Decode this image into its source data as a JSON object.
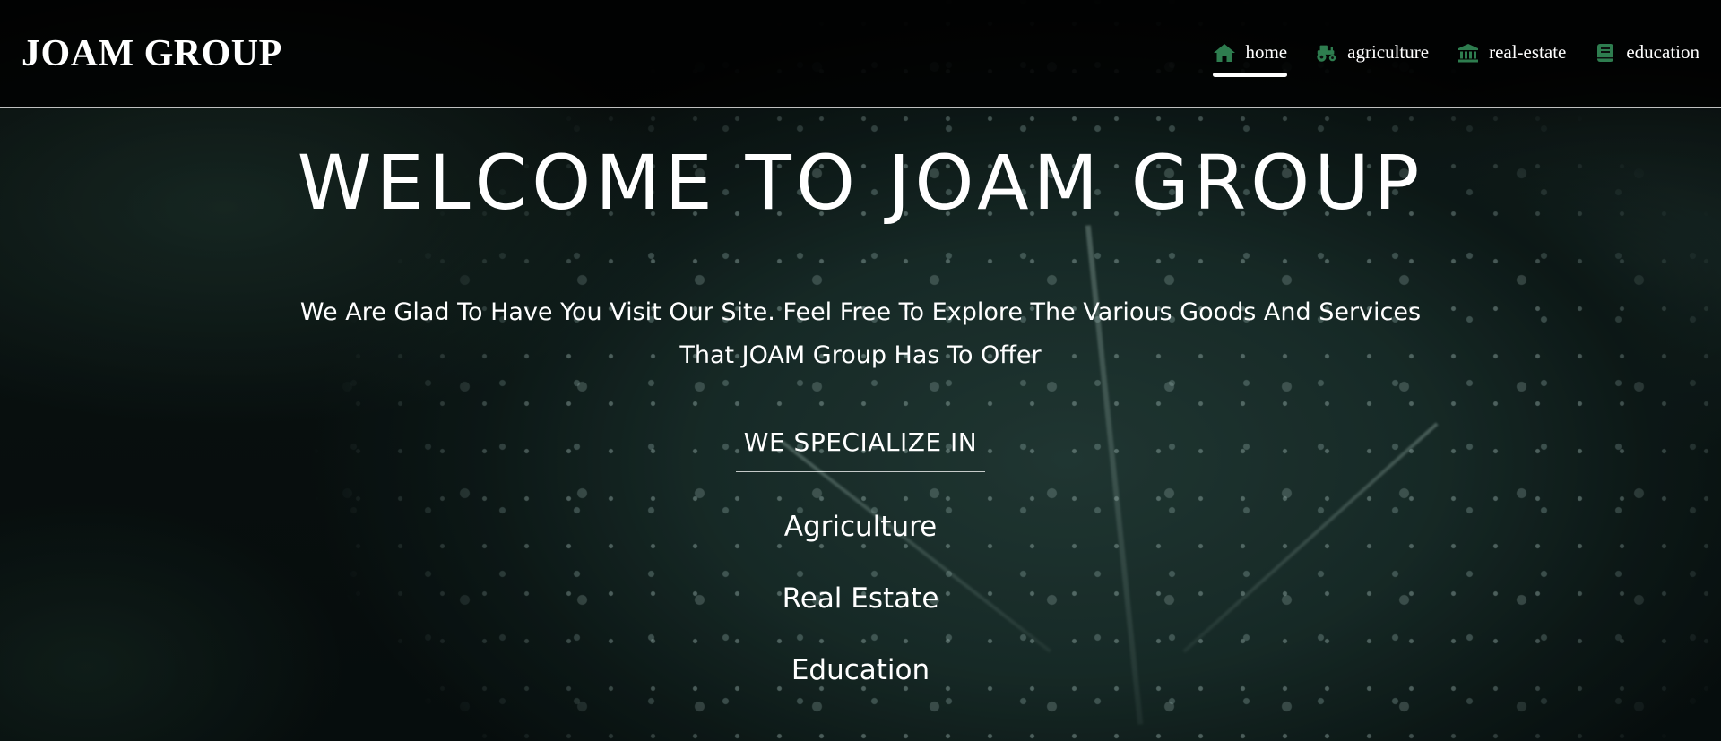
{
  "header": {
    "brand": "JOAM GROUP",
    "nav": [
      {
        "label": "home",
        "icon": "home-icon",
        "active": true
      },
      {
        "label": "agriculture",
        "icon": "tractor-icon",
        "active": false
      },
      {
        "label": "real-estate",
        "icon": "bank-building-icon",
        "active": false
      },
      {
        "label": "education",
        "icon": "book-icon",
        "active": false
      }
    ],
    "icon_color": "#2e7d4f"
  },
  "main": {
    "title": "WELCOME TO JOAM GROUP",
    "subtitle": "We Are Glad To Have You Visit Our Site. Feel Free To Explore The Various Goods And Services That JOAM Group Has To Offer",
    "specialize_heading": "WE SPECIALIZE IN",
    "specialties": [
      "Agriculture",
      "Real Estate",
      "Education"
    ]
  }
}
